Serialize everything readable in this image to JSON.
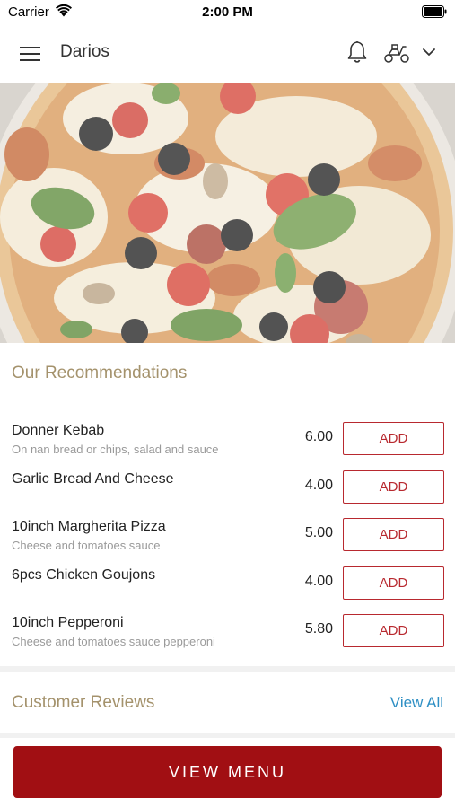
{
  "status_bar": {
    "carrier": "Carrier",
    "time": "2:00 PM"
  },
  "nav": {
    "title": "Darios",
    "icons": [
      "menu-icon",
      "bell-icon",
      "scooter-icon",
      "chevron-down-icon"
    ]
  },
  "hero": {
    "image": "pizza with olives, tomatoes and basil"
  },
  "recommendations": {
    "title": "Our Recommendations",
    "add_label": "ADD",
    "items": [
      {
        "name": "Donner Kebab",
        "description": "On nan bread or chips, salad and sauce",
        "price": "6.00"
      },
      {
        "name": "Garlic Bread And Cheese",
        "description": "",
        "price": "4.00"
      },
      {
        "name": "10inch Margherita Pizza",
        "description": "Cheese and tomatoes sauce",
        "price": "5.00"
      },
      {
        "name": "6pcs Chicken Goujons",
        "description": "",
        "price": "4.00"
      },
      {
        "name": "10inch Pepperoni",
        "description": "Cheese and tomatoes sauce pepperoni",
        "price": "5.80"
      }
    ]
  },
  "reviews": {
    "title": "Customer Reviews",
    "view_all": "View All"
  },
  "footer": {
    "view_menu": "VIEW MENU"
  },
  "colors": {
    "accent_red": "#a10f13",
    "button_red": "#b8292f",
    "gold": "#a4926c",
    "link_blue": "#2e8fc4"
  }
}
